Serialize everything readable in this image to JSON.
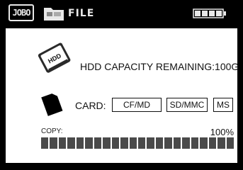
{
  "topbar": {
    "logo_text": "JOBO",
    "folder_icon": "folder-icon",
    "file_label": "FILE",
    "battery_icon": "battery-icon",
    "battery_level": 1.0
  },
  "hdd": {
    "icon": "hard-drive-icon",
    "icon_label": "HDD",
    "capacity_text": "HDD CAPACITY REMAINING:100G"
  },
  "card": {
    "icon": "memory-card-icon",
    "label": "CARD:",
    "options": [
      "CF/MD",
      "SD/MMC",
      "MS"
    ]
  },
  "copy": {
    "label": "COPY:",
    "percent_text": "100%",
    "progress": 1.0,
    "segments": 22
  },
  "colors": {
    "background": "#000000",
    "panel": "#ffffff",
    "progress_fill": "#4a4a4a"
  }
}
